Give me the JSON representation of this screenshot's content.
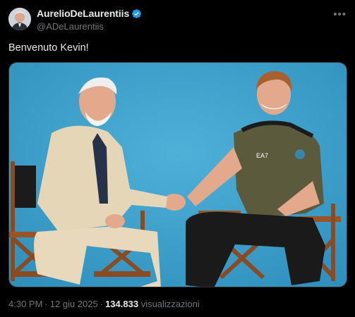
{
  "author": {
    "display_name": "AurelioDeLaurentiis",
    "handle": "@ADeLaurentiis",
    "verified": true
  },
  "tweet": {
    "text": "Benvenuto Kevin!"
  },
  "media": {
    "jersey_text": "EA7"
  },
  "meta": {
    "time": "4:30 PM",
    "separator": "·",
    "date": "12 giu 2025",
    "views_count": "134.833",
    "views_label": "visualizzazioni"
  },
  "colors": {
    "background": "#000000",
    "verified_badge": "#1d9bf0",
    "photo_backdrop": "#3a9fc9"
  },
  "icons": {
    "verified": "verified-badge-icon",
    "more": "more-options-icon"
  }
}
